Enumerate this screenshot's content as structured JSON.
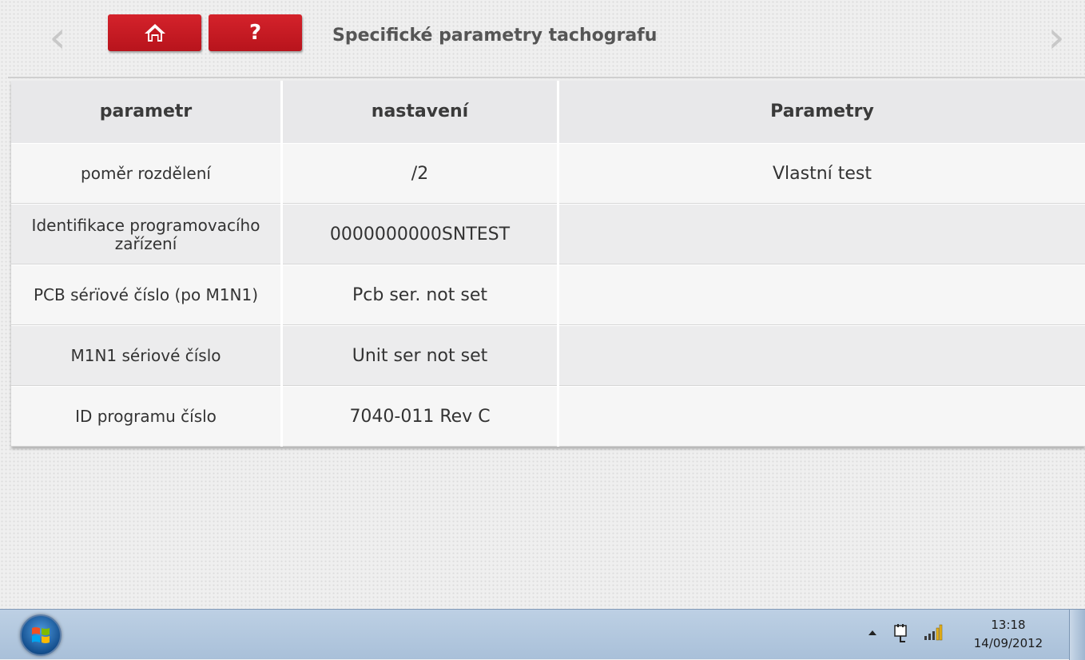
{
  "header": {
    "title": "Specifické parametry tachografu",
    "help_label": "?",
    "prev_label": "‹",
    "next_label": "›"
  },
  "table": {
    "columns": [
      "parametr",
      "nastavení",
      "Parametry"
    ],
    "rows": [
      [
        "poměr rozdělení",
        "/2",
        "Vlastní test"
      ],
      [
        "Identifikace programovacího zařízení",
        "0000000000SNTEST",
        ""
      ],
      [
        "PCB sérïové číslo (po M1N1)",
        "Pcb ser. not set",
        ""
      ],
      [
        "M1N1 sériové číslo",
        "Unit ser not set",
        ""
      ],
      [
        "ID programu číslo",
        "7040-011 Rev C",
        ""
      ]
    ]
  },
  "taskbar": {
    "time": "13:18",
    "date": "14/09/2012"
  },
  "colors": {
    "accent_red": "#c8181f",
    "taskbar_blue": "#b3c8df"
  }
}
